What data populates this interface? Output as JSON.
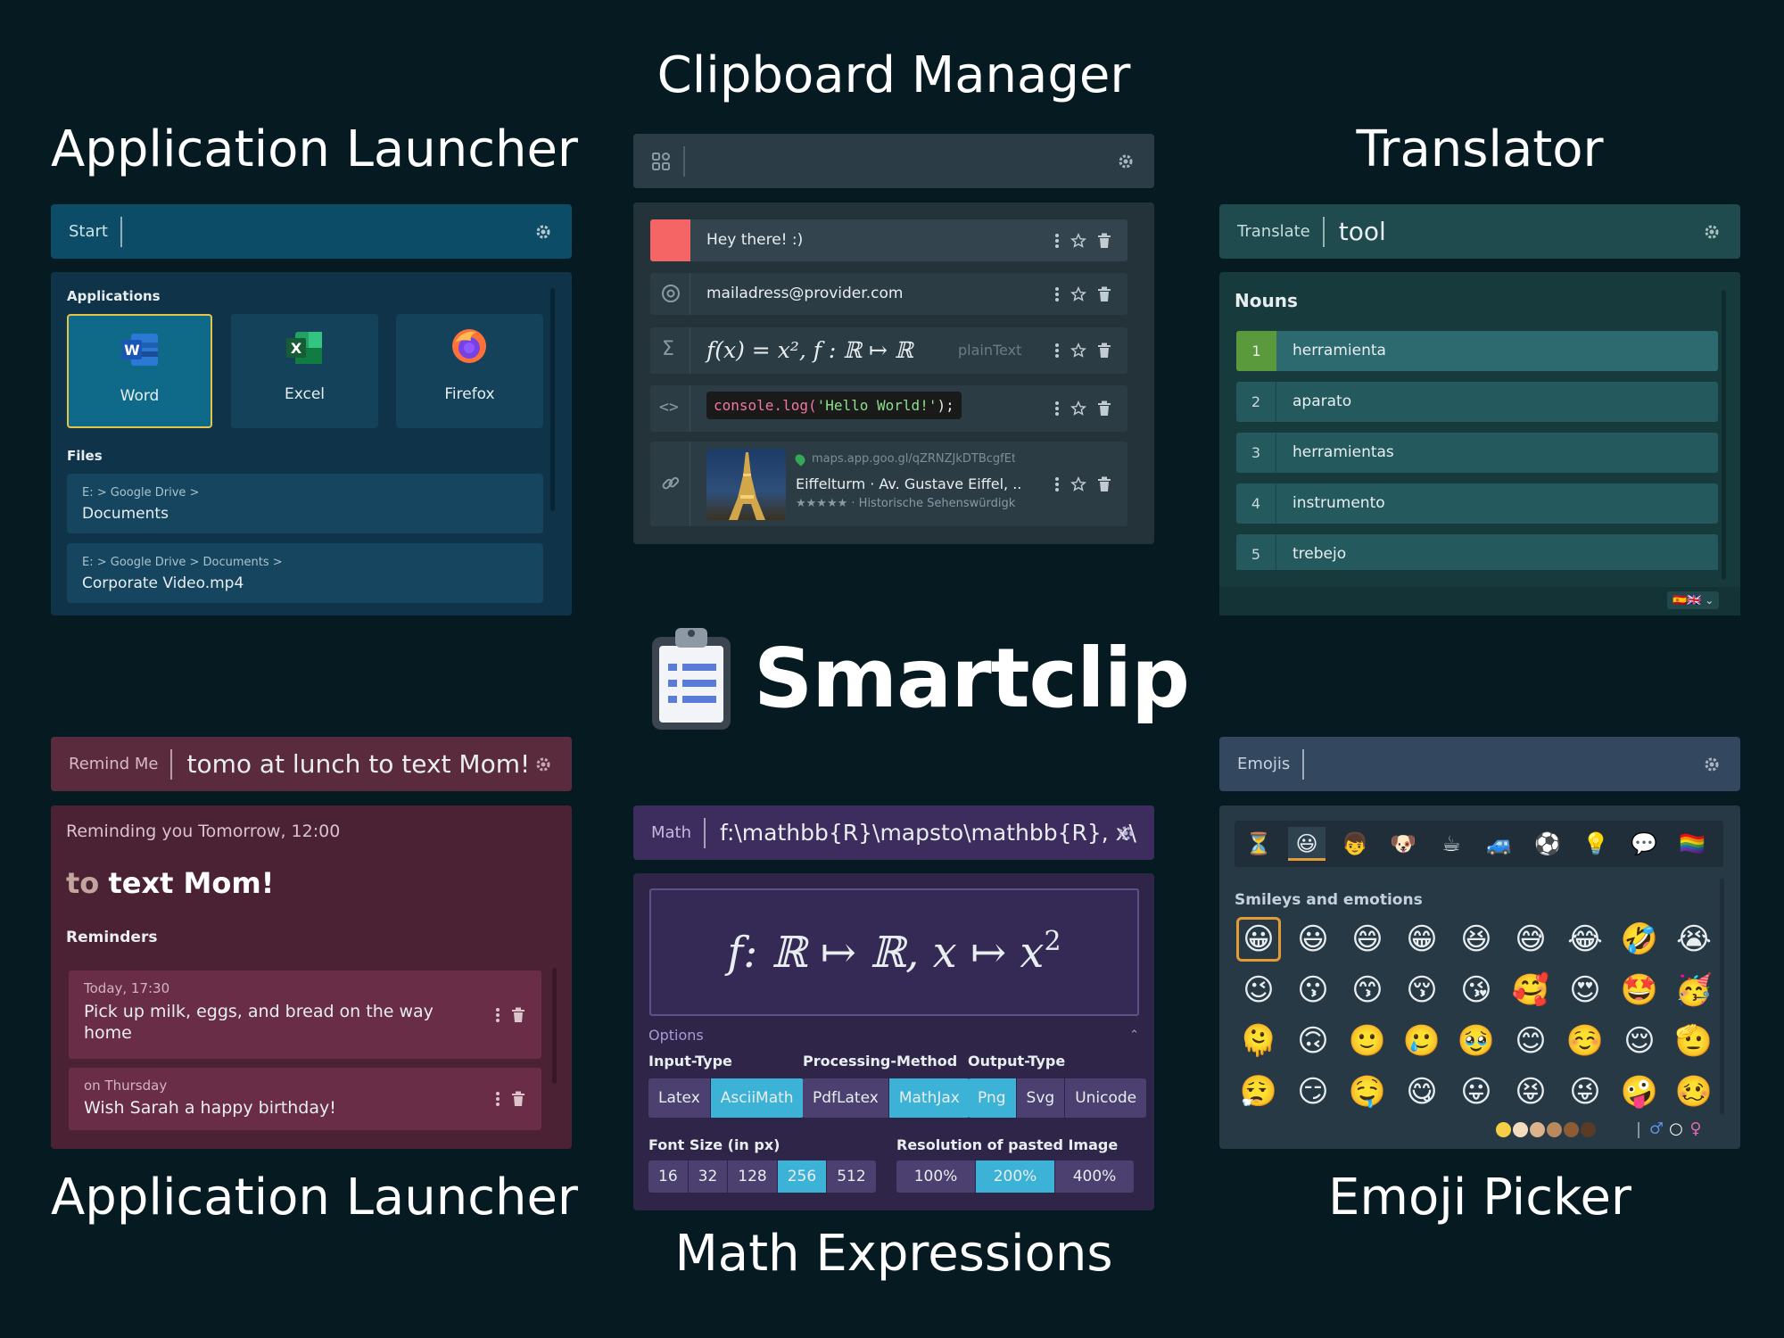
{
  "brand": {
    "name": "Smartclip",
    "logo_icon": "clipboard-icon"
  },
  "captions": {
    "app_launcher_top": "Application Launcher",
    "clipboard": "Clipboard Manager",
    "translator": "Translator",
    "app_launcher_bottom": "Application Launcher",
    "math": "Math Expressions",
    "emoji": "Emoji Picker"
  },
  "launcher": {
    "prefix": "Start",
    "query": "",
    "applications_title": "Applications",
    "apps": [
      {
        "label": "Word",
        "icon": "word-icon"
      },
      {
        "label": "Excel",
        "icon": "excel-icon"
      },
      {
        "label": "Firefox",
        "icon": "firefox-icon"
      }
    ],
    "files_title": "Files",
    "files": [
      {
        "path": "E: > Google Drive >",
        "name": "Documents"
      },
      {
        "path": "E: > Google Drive > Documents >",
        "name": "Corporate Video.mp4"
      }
    ],
    "colors": {
      "bar": "#0c4c66",
      "panel": "#0f3348",
      "tile": "#14425a",
      "selected": "#0f6a8a",
      "accent": "#e3c34a"
    }
  },
  "clipboard": {
    "query": "",
    "items": [
      {
        "type": "color",
        "text": "Hey there! :)",
        "swatch": "#f56565"
      },
      {
        "type": "email",
        "icon": "at-icon",
        "text": "mailadress@provider.com"
      },
      {
        "type": "math",
        "icon": "sigma-icon",
        "text": "f(x) = x², f : ℝ ↦ ℝ",
        "hint": "plainText"
      },
      {
        "type": "code",
        "icon": "code-icon",
        "code_fn": "console.log(",
        "code_str": "'Hello World!'",
        "code_end": ");"
      },
      {
        "type": "link",
        "icon": "link-icon",
        "url": "maps.app.goo.gl/qZRNZJkDTBcgfEt",
        "title": "Eiffelturm · Av. Gustave Eiffel, ...",
        "meta": "★★★★★ · Historische Sehenswürdigk"
      }
    ],
    "colors": {
      "bar": "#2b3c46",
      "panel": "#243239",
      "item": "#33444e"
    }
  },
  "translator": {
    "prefix": "Translate",
    "query": "tool",
    "section": "Nouns",
    "results": [
      {
        "n": "1",
        "word": "herramienta"
      },
      {
        "n": "2",
        "word": "aparato"
      },
      {
        "n": "3",
        "word": "herramientas"
      },
      {
        "n": "4",
        "word": "instrumento"
      },
      {
        "n": "5",
        "word": "trebejo"
      }
    ],
    "flags": "🇪🇸🇬🇧",
    "colors": {
      "bar": "#1f4a4e",
      "panel": "#173a3d",
      "row": "#245a5e",
      "selected": "#2d6a6f",
      "badge": "#5b9a3c"
    }
  },
  "reminder": {
    "prefix": "Remind Me",
    "query": "tomo at lunch to text Mom!",
    "status": "Reminding you Tomorrow, 12:00",
    "preview_dim": "to",
    "preview_bold": "text Mom!",
    "list_title": "Reminders",
    "items": [
      {
        "when": "Today, 17:30",
        "text": "Pick up milk, eggs, and bread on the way home"
      },
      {
        "when": "on Thursday",
        "text": "Wish Sarah a happy birthday!"
      }
    ],
    "colors": {
      "bar": "#5a2a3d",
      "panel": "#4b2234",
      "item": "#6a2d47"
    }
  },
  "math": {
    "prefix": "Math",
    "query": "f:\\mathbb{R}\\mapsto\\mathbb{R}, x\\",
    "rendered_main": "f: ℝ ↦ ℝ, x ↦ x",
    "rendered_exp": "2",
    "options_label": "Options",
    "input_type": {
      "label": "Input-Type",
      "options": [
        "Latex",
        "AsciiMath"
      ],
      "selected": 1
    },
    "processing": {
      "label": "Processing-Method",
      "options": [
        "PdfLatex",
        "MathJax"
      ],
      "selected": 1
    },
    "output_type": {
      "label": "Output-Type",
      "options": [
        "Png",
        "Svg",
        "Unicode"
      ],
      "selected": 0
    },
    "font_size": {
      "label": "Font Size (in px)",
      "options": [
        "16",
        "32",
        "128",
        "256",
        "512"
      ],
      "selected": 3
    },
    "resolution": {
      "label": "Resolution of pasted Image",
      "options": [
        "100%",
        "200%",
        "400%"
      ],
      "selected": 1
    },
    "colors": {
      "bar": "#3d2d5e",
      "panel": "#2e2548",
      "seg": "#4b4070",
      "active": "#3bb2d6"
    }
  },
  "emoji": {
    "prefix": "Emojis",
    "query": "",
    "categories": [
      "⏳",
      "😃",
      "👦",
      "🐶",
      "☕",
      "🚙",
      "⚽",
      "💡",
      "💬",
      "🏳️‍🌈"
    ],
    "selected_category": 1,
    "section": "Smileys and emotions",
    "grid": [
      [
        "😀",
        "😃",
        "😄",
        "😁",
        "😆",
        "😅",
        "😂",
        "🤣",
        "😭"
      ],
      [
        "😉",
        "😗",
        "😙",
        "😚",
        "😘",
        "🥰",
        "😍",
        "🤩",
        "🥳"
      ],
      [
        "🫠",
        "🙃",
        "🙂",
        "🥲",
        "🥹",
        "😊",
        "☺️",
        "😌",
        "🫡"
      ],
      [
        "😮‍💨",
        "😏",
        "🤤",
        "😋",
        "😛",
        "😝",
        "😜",
        "🤪",
        "🥴"
      ]
    ],
    "skin_tones": [
      "#f7cf46",
      "#f3dcc0",
      "#dcb38c",
      "#b98a5e",
      "#8d5b34",
      "#5a3b25"
    ],
    "genders": [
      "♂",
      "○",
      "♀"
    ],
    "colors": {
      "bar": "#33475e",
      "panel": "#283946",
      "tabbar": "#1f2e39"
    }
  }
}
